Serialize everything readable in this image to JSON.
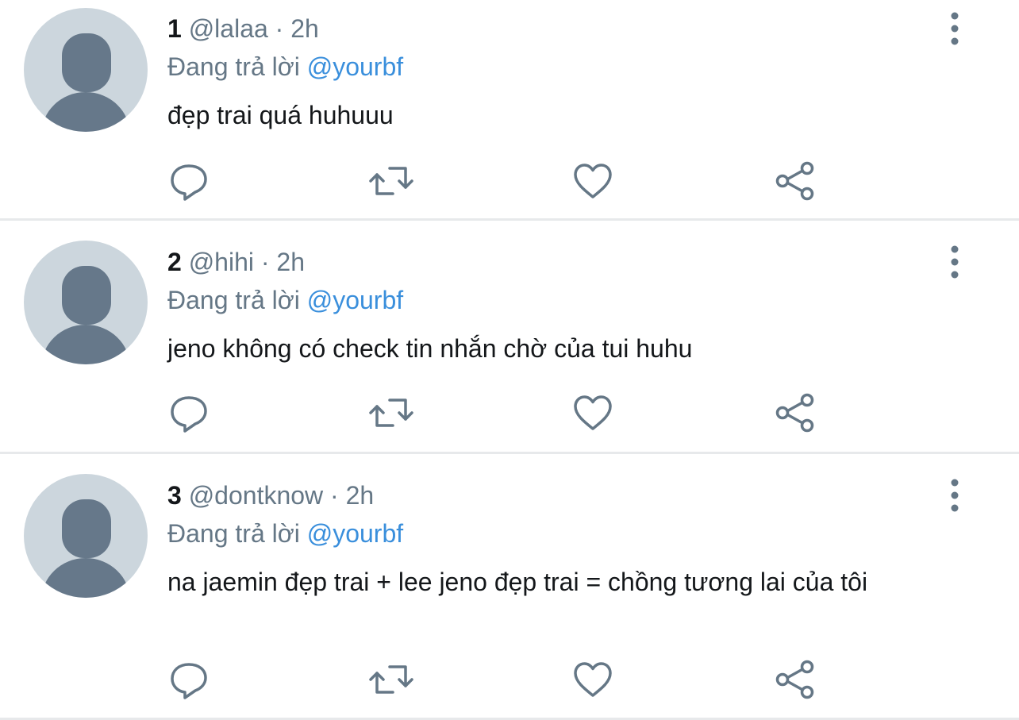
{
  "colors": {
    "icon_gray": "#657786",
    "mention_blue": "#3a8fdc",
    "avatar_bg": "#ccd6dd",
    "avatar_fg": "#66788a",
    "divider": "#e7e9eb"
  },
  "tweets": [
    {
      "rank": "1",
      "handle": "@lalaa",
      "time": "· 2h",
      "reply_prefix": "Đang trả lời",
      "reply_to": "@yourbf",
      "text": "đẹp trai quá huhuuu"
    },
    {
      "rank": "2",
      "handle": "@hihi",
      "time": "· 2h",
      "reply_prefix": "Đang trả lời",
      "reply_to": "@yourbf",
      "text": "jeno không có check tin nhắn chờ của tui huhu"
    },
    {
      "rank": "3",
      "handle": "@dontknow",
      "time": "· 2h",
      "reply_prefix": "Đang trả lời",
      "reply_to": "@yourbf",
      "text": "na jaemin đẹp trai + lee jeno đẹp trai = chồng tương lai của tôi"
    }
  ],
  "icons": {
    "reply": "speech-bubble-icon",
    "retweet": "retweet-icon",
    "like": "heart-icon",
    "share": "share-icon",
    "more": "vertical-ellipsis-icon",
    "avatar": "default-profile-icon"
  }
}
